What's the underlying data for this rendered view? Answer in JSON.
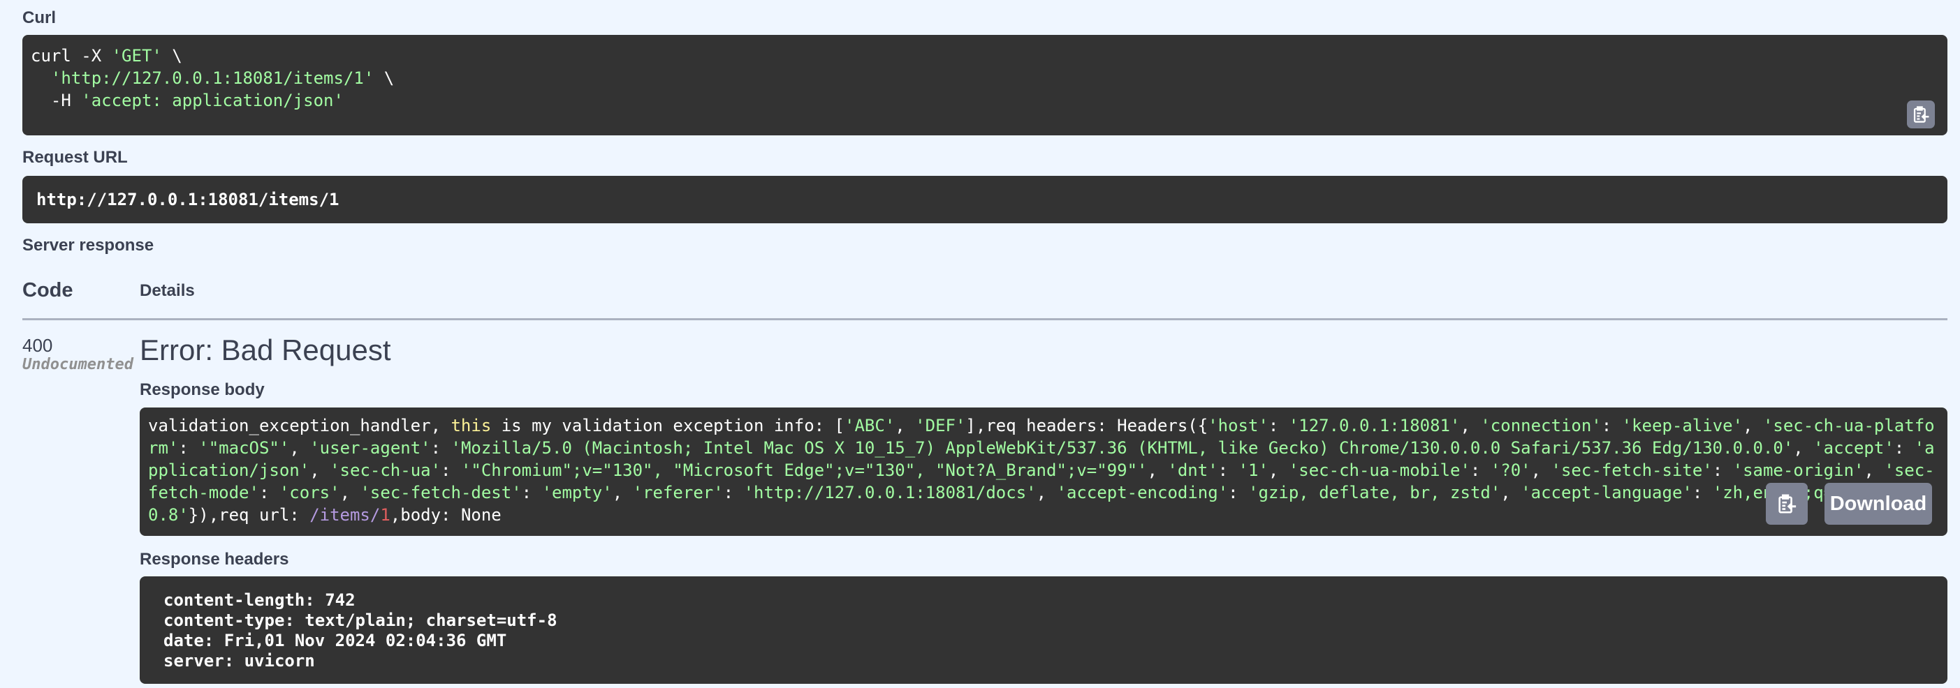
{
  "curl": {
    "label": "Curl",
    "lines": [
      {
        "prefix": "curl -X ",
        "str": "'GET'",
        "suffix": " \\"
      },
      {
        "prefix": "  ",
        "str": "'http://127.0.0.1:18081/items/1'",
        "suffix": " \\"
      },
      {
        "prefix": "  -H ",
        "str": "'accept: application/json'",
        "suffix": ""
      }
    ],
    "copy_icon": "clipboard-copy-icon"
  },
  "request_url": {
    "label": "Request URL",
    "value": "http://127.0.0.1:18081/items/1"
  },
  "server_response": {
    "label": "Server response",
    "columns": {
      "code": "Code",
      "details": "Details"
    },
    "status_code": "400",
    "status_note": "Undocumented",
    "error_title": "Error: Bad Request",
    "response_body": {
      "label": "Response body",
      "segments": [
        {
          "t": "validation_exception_handler, ",
          "c": "w"
        },
        {
          "t": "this",
          "c": "kw"
        },
        {
          "t": " is my validation exception info: [",
          "c": "w"
        },
        {
          "t": "'ABC'",
          "c": "g"
        },
        {
          "t": ", ",
          "c": "w"
        },
        {
          "t": "'DEF'",
          "c": "g"
        },
        {
          "t": "],req headers: Headers({",
          "c": "w"
        },
        {
          "t": "'host'",
          "c": "g"
        },
        {
          "t": ": ",
          "c": "w"
        },
        {
          "t": "'127.0.0.1:18081'",
          "c": "g"
        },
        {
          "t": ", ",
          "c": "w"
        },
        {
          "t": "'connection'",
          "c": "g"
        },
        {
          "t": ": ",
          "c": "w"
        },
        {
          "t": "'keep-alive'",
          "c": "g"
        },
        {
          "t": ", ",
          "c": "w"
        },
        {
          "t": "'sec-ch-ua-platform'",
          "c": "g"
        },
        {
          "t": ": ",
          "c": "w"
        },
        {
          "t": "'\"macOS\"'",
          "c": "g"
        },
        {
          "t": ", ",
          "c": "w"
        },
        {
          "t": "'user-agent'",
          "c": "g"
        },
        {
          "t": ": ",
          "c": "w"
        },
        {
          "t": "'Mozilla/5.0 (Macintosh; Intel Mac OS X 10_15_7) AppleWebKit/537.36 (KHTML, like Gecko) Chrome/130.0.0.0 Safari/537.36 Edg/130.0.0.0'",
          "c": "g"
        },
        {
          "t": ", ",
          "c": "w"
        },
        {
          "t": "'accept'",
          "c": "g"
        },
        {
          "t": ": ",
          "c": "w"
        },
        {
          "t": "'application/json'",
          "c": "g"
        },
        {
          "t": ", ",
          "c": "w"
        },
        {
          "t": "'sec-ch-ua'",
          "c": "g"
        },
        {
          "t": ": ",
          "c": "w"
        },
        {
          "t": "'\"Chromium\";v=\"130\", \"Microsoft Edge\";v=\"130\", \"Not?A_Brand\";v=\"99\"'",
          "c": "g"
        },
        {
          "t": ", ",
          "c": "w"
        },
        {
          "t": "'dnt'",
          "c": "g"
        },
        {
          "t": ": ",
          "c": "w"
        },
        {
          "t": "'1'",
          "c": "g"
        },
        {
          "t": ", ",
          "c": "w"
        },
        {
          "t": "'sec-ch-ua-mobile'",
          "c": "g"
        },
        {
          "t": ": ",
          "c": "w"
        },
        {
          "t": "'?0'",
          "c": "g"
        },
        {
          "t": ", ",
          "c": "w"
        },
        {
          "t": "'sec-fetch-site'",
          "c": "g"
        },
        {
          "t": ": ",
          "c": "w"
        },
        {
          "t": "'same-origin'",
          "c": "g"
        },
        {
          "t": ", ",
          "c": "w"
        },
        {
          "t": "'sec-fetch-mode'",
          "c": "g"
        },
        {
          "t": ": ",
          "c": "w"
        },
        {
          "t": "'cors'",
          "c": "g"
        },
        {
          "t": ", ",
          "c": "w"
        },
        {
          "t": "'sec-fetch-dest'",
          "c": "g"
        },
        {
          "t": ": ",
          "c": "w"
        },
        {
          "t": "'empty'",
          "c": "g"
        },
        {
          "t": ", ",
          "c": "w"
        },
        {
          "t": "'referer'",
          "c": "g"
        },
        {
          "t": ": ",
          "c": "w"
        },
        {
          "t": "'http://127.0.0.1:18081/docs'",
          "c": "g"
        },
        {
          "t": ", ",
          "c": "w"
        },
        {
          "t": "'accept-encoding'",
          "c": "g"
        },
        {
          "t": ": ",
          "c": "w"
        },
        {
          "t": "'gzip, deflate, br, zstd'",
          "c": "g"
        },
        {
          "t": ", ",
          "c": "w"
        },
        {
          "t": "'accept-language'",
          "c": "g"
        },
        {
          "t": ": ",
          "c": "w"
        },
        {
          "t": "'zh,en-US;q=0.9,en;q=0.8'",
          "c": "g"
        },
        {
          "t": "}),req url: ",
          "c": "w"
        },
        {
          "t": "/items/",
          "c": "pu"
        },
        {
          "t": "1",
          "c": "rd"
        },
        {
          "t": ",body: None",
          "c": "w"
        }
      ],
      "copy_icon": "clipboard-copy-icon",
      "download_label": "Download"
    },
    "response_headers": {
      "label": "Response headers",
      "lines": [
        "content-length: 742",
        "content-type: text/plain; charset=utf-8",
        "date: Fri,01 Nov 2024 02:04:36 GMT",
        "server: uvicorn"
      ]
    }
  }
}
